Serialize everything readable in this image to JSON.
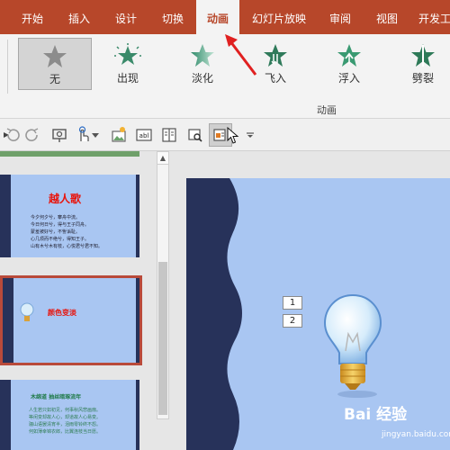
{
  "tabs": [
    {
      "label": "开始"
    },
    {
      "label": "插入"
    },
    {
      "label": "设计"
    },
    {
      "label": "切换"
    },
    {
      "label": "动画",
      "active": true
    },
    {
      "label": "幻灯片放映"
    },
    {
      "label": "审阅"
    },
    {
      "label": "视图"
    },
    {
      "label": "开发工"
    }
  ],
  "animations": [
    {
      "label": "无",
      "icon": "star-none-icon",
      "selected": true
    },
    {
      "label": "出现",
      "icon": "star-appear-icon"
    },
    {
      "label": "淡化",
      "icon": "star-fade-icon"
    },
    {
      "label": "飞入",
      "icon": "star-fly-in-icon"
    },
    {
      "label": "浮入",
      "icon": "star-float-in-icon"
    },
    {
      "label": "劈裂",
      "icon": "star-split-icon"
    }
  ],
  "group_label": "动画",
  "toolbar_icons": [
    "undo-icon",
    "redo-icon",
    "slideshow-icon",
    "touch-icon",
    "picture-icon",
    "textbox-icon",
    "text-columns-icon",
    "find-icon",
    "selection-pane-icon",
    "cursor-icon",
    "more-icon"
  ],
  "slides": [
    {
      "title": "越人歌",
      "body": [
        "今夕何夕兮，搴舟中流。",
        "今日何日兮，得与王子同舟。",
        "蒙羞被好兮，不訾诟耻。",
        "心几烦而不绝兮，得知王子。",
        "山有木兮木有枝，心悦君兮君不知。"
      ]
    },
    {
      "title": "颜色变淡",
      "selected": true
    },
    {
      "title": "木绵道 抽丝暗琢流年",
      "body": [
        "人生若只如初见，何事秋风悲画扇。",
        "等闲变却故人心，却道故人心易变。",
        "骊山语罢清宵半，泪雨零铃终不怨。",
        "何如薄幸锦衣郎，比翼连枝当日愿。"
      ]
    }
  ],
  "order_tags": [
    "1",
    "2"
  ],
  "watermark": {
    "logo": "Bai 经验",
    "url": "jingyan.baidu.com"
  },
  "colors": {
    "accent": "#b7472a",
    "slide_bg": "#a9c6f2",
    "spine": "#27325a",
    "annotation_arrow": "#e02020"
  }
}
